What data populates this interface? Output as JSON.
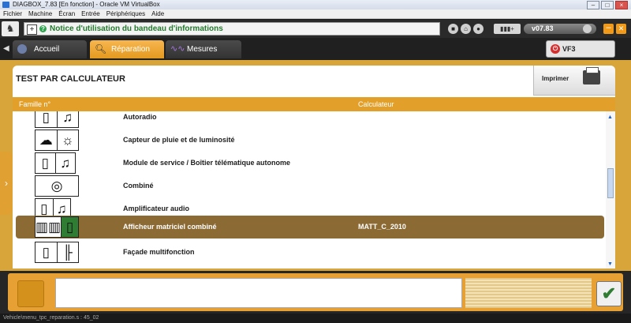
{
  "window": {
    "title": "DIAGBOX_7.83 [En fonction] - Oracle VM VirtualBox"
  },
  "menu": [
    "Fichier",
    "Machine",
    "Écran",
    "Entrée",
    "Périphériques",
    "Aide"
  ],
  "toolbar": {
    "info_message": "Notice d'utilisation du bandeau d'informations",
    "version": "v07.83"
  },
  "tabs": [
    {
      "label": "Accueil"
    },
    {
      "label": "Réparation"
    },
    {
      "label": "Mesures"
    }
  ],
  "vehicle": {
    "label": "VF3"
  },
  "panel": {
    "title": "TEST PAR CALCULATEUR",
    "print_label": "Imprimer"
  },
  "table": {
    "col_family": "Famille n°",
    "col_calculator": "Calculateur",
    "rows": [
      {
        "name": "Autoradio",
        "calc": ""
      },
      {
        "name": "Capteur de pluie et de luminosité",
        "calc": ""
      },
      {
        "name": "Module de service / Boîtier télématique autonome",
        "calc": ""
      },
      {
        "name": "Combiné",
        "calc": ""
      },
      {
        "name": "Amplificateur audio",
        "calc": ""
      },
      {
        "name": "Afficheur matriciel combiné",
        "calc": "MATT_C_2010"
      },
      {
        "name": "Façade multifonction",
        "calc": ""
      }
    ]
  },
  "status": {
    "path": "Vehicle\\menu_tpc_reparation.s : 45_02"
  },
  "colors": {
    "accent": "#e2a02b",
    "selected_row": "#8c6a34"
  }
}
